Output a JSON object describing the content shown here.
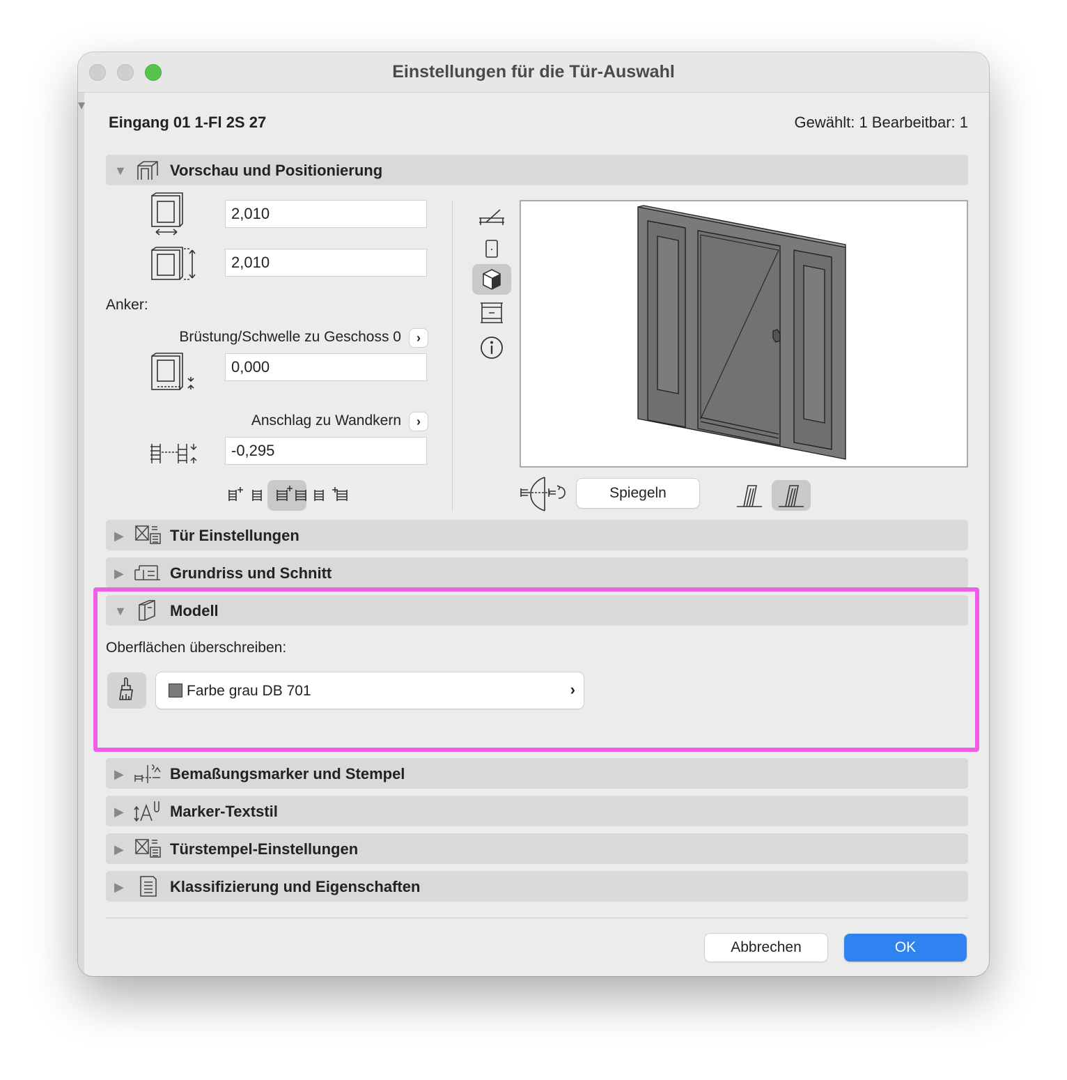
{
  "window": {
    "title": "Einstellungen für die Tür-Auswahl"
  },
  "header": {
    "name": "Eingang 01 1-Fl 2S 27",
    "selection": "Gewählt: 1 Bearbeitbar: 1"
  },
  "preview_section": {
    "title": "Vorschau und Positionierung",
    "width_value": "2,010",
    "height_value": "2,010",
    "anchor_label": "Anker:",
    "sill_label": "Brüstung/Schwelle zu Geschoss 0",
    "sill_value": "0,000",
    "reveal_label": "Anschlag zu Wandkern",
    "reveal_value": "-0,295",
    "mirror_button": "Spiegeln"
  },
  "sections": {
    "door_settings": "Tür Einstellungen",
    "floor_plan": "Grundriss und Schnitt",
    "model": "Modell",
    "dimension_markers": "Bemaßungsmarker und Stempel",
    "marker_text": "Marker-Textstil",
    "door_stamp": "Türstempel-Einstellungen",
    "classification": "Klassifizierung und Eigenschaften"
  },
  "model": {
    "override_label": "Oberflächen überschreiben:",
    "surface": "Farbe grau DB 701",
    "surface_color": "#7b7b7b"
  },
  "footer": {
    "cancel": "Abbrechen",
    "ok": "OK"
  },
  "colors": {
    "accent": "#2f83f0",
    "highlight": "#ee5ee6"
  }
}
